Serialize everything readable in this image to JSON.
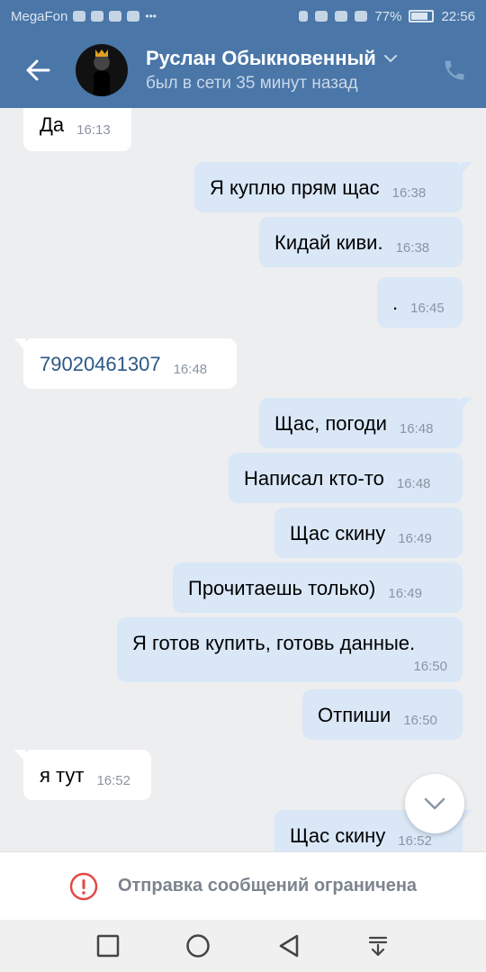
{
  "status_bar": {
    "carrier": "MegaFon",
    "battery": "77%",
    "time": "22:56"
  },
  "header": {
    "contact_name": "Руслан Обыкновенный",
    "last_seen": "был в сети 35 минут назад"
  },
  "messages": [
    {
      "dir": "in",
      "text": "Да",
      "time": "16:13"
    },
    {
      "dir": "out",
      "text": "Я куплю прям щас",
      "time": "16:38"
    },
    {
      "dir": "out",
      "text": "Кидай киви.",
      "time": "16:38"
    },
    {
      "dir": "out",
      "text": ".",
      "time": "16:45"
    },
    {
      "dir": "in",
      "text": "79020461307",
      "time": "16:48"
    },
    {
      "dir": "out",
      "text": "Щас, погоди",
      "time": "16:48"
    },
    {
      "dir": "out",
      "text": "Написал кто-то",
      "time": "16:48"
    },
    {
      "dir": "out",
      "text": "Щас скину",
      "time": "16:49"
    },
    {
      "dir": "out",
      "text": "Прочитаешь только)",
      "time": "16:49"
    },
    {
      "dir": "out",
      "text": "Я готов купить, готовь данные.",
      "time": "16:50"
    },
    {
      "dir": "out",
      "text": "Отпиши",
      "time": "16:50"
    },
    {
      "dir": "in",
      "text": "я тут",
      "time": "16:52"
    },
    {
      "dir": "out",
      "text": "Щас скину",
      "time": "16:52"
    }
  ],
  "restriction_notice": "Отправка сообщений ограничена",
  "colors": {
    "header_bg": "#4a76a8",
    "chat_bg": "#edeef0",
    "outgoing_bubble": "#d9e7f7",
    "incoming_bubble": "#ffffff",
    "link": "#2a5885",
    "alert": "#e64646"
  }
}
